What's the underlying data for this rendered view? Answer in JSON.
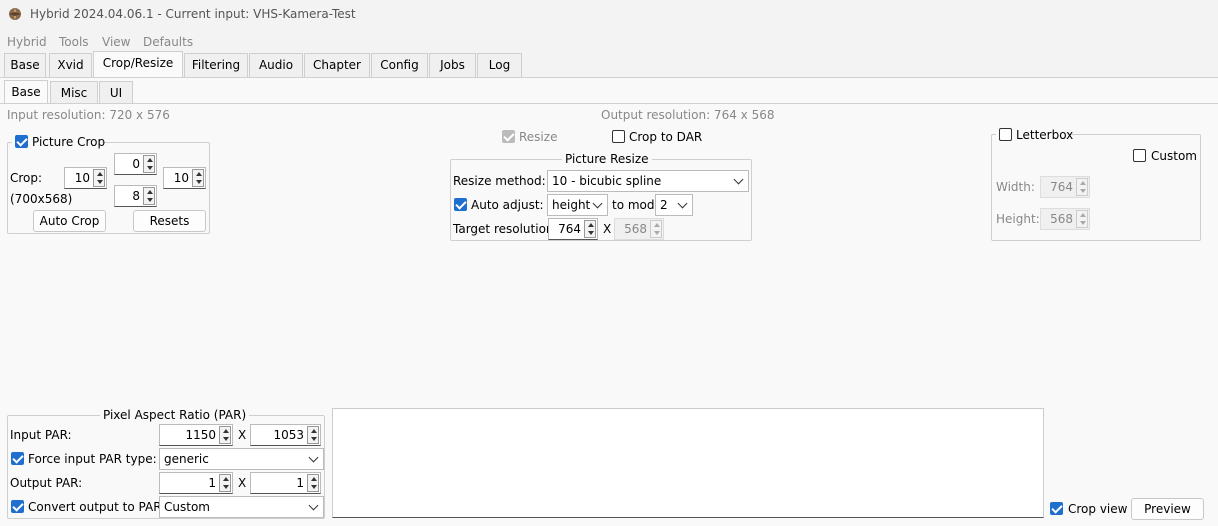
{
  "window": {
    "title": "Hybrid 2024.04.06.1 - Current input: VHS-Kamera-Test"
  },
  "menu": [
    "Hybrid",
    "Tools",
    "View",
    "Defaults"
  ],
  "main_tabs": [
    "Base",
    "Xvid",
    "Crop/Resize",
    "Filtering",
    "Audio",
    "Chapter",
    "Config",
    "Jobs",
    "Log"
  ],
  "sub_tabs": [
    "Base",
    "Misc",
    "UI"
  ],
  "input_resolution": "Input resolution: 720 x 576",
  "output_resolution": "Output resolution: 764 x 568",
  "crop": {
    "group_label": "Picture Crop",
    "crop_label": "Crop:",
    "size_label": "(700x568)",
    "top": "0",
    "left": "10",
    "right": "10",
    "bottom": "8",
    "auto_crop": "Auto Crop",
    "resets": "Resets"
  },
  "resize": {
    "resize_label": "Resize",
    "crop_to_dar": "Crop to DAR",
    "group_label": "Picture Resize",
    "method_label": "Resize method:",
    "method_value": "10 - bicubic spline",
    "auto_adjust": "Auto adjust:",
    "adjust_value": "height",
    "to_mod": "to mod",
    "mod_value": "2",
    "target_label": "Target resolution:",
    "target_w": "764",
    "x": "X",
    "target_h": "568"
  },
  "letterbox": {
    "label": "Letterbox",
    "custom": "Custom",
    "width_label": "Width:",
    "width": "764",
    "height_label": "Height:",
    "height": "568"
  },
  "par": {
    "group_label": "Pixel Aspect Ratio (PAR)",
    "input_par": "Input PAR:",
    "in_w": "1150",
    "x": "X",
    "in_h": "1053",
    "force_label": "Force input PAR type:",
    "force_value": "generic",
    "output_par": "Output PAR:",
    "out_w": "1",
    "out_h": "1",
    "convert_label": "Convert output to PAR:",
    "convert_value": "Custom"
  },
  "bottom": {
    "crop_view": "Crop view",
    "preview": "Preview"
  }
}
